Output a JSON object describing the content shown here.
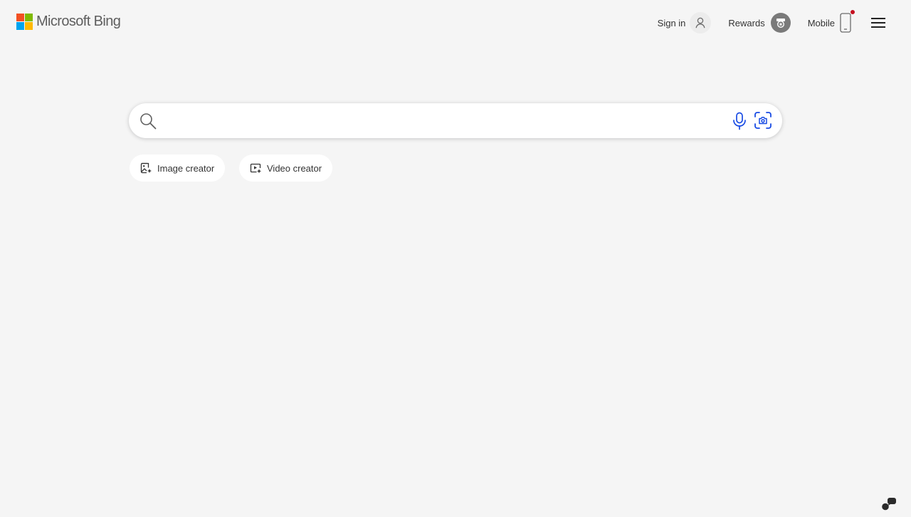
{
  "header": {
    "logo_text": "Microsoft Bing",
    "sign_in_label": "Sign in",
    "rewards_label": "Rewards",
    "mobile_label": "Mobile",
    "mobile_notification": true
  },
  "search": {
    "value": "",
    "placeholder": ""
  },
  "chips": [
    {
      "label": "Image creator",
      "icon": "image-creator-icon"
    },
    {
      "label": "Video creator",
      "icon": "video-creator-icon"
    }
  ],
  "colors": {
    "background": "#f5f5f5",
    "accent_blue": "#174ae4",
    "notification_red": "#c50f1f",
    "logo_red": "#f25022",
    "logo_green": "#7fba00",
    "logo_blue": "#00a4ef",
    "logo_yellow": "#ffb900"
  },
  "icons": [
    "microsoft-logo-icon",
    "user-icon",
    "rewards-icon",
    "mobile-phone-icon",
    "hamburger-menu-icon",
    "search-icon",
    "microphone-icon",
    "visual-search-icon",
    "image-creator-icon",
    "video-creator-icon",
    "feedback-icon"
  ]
}
